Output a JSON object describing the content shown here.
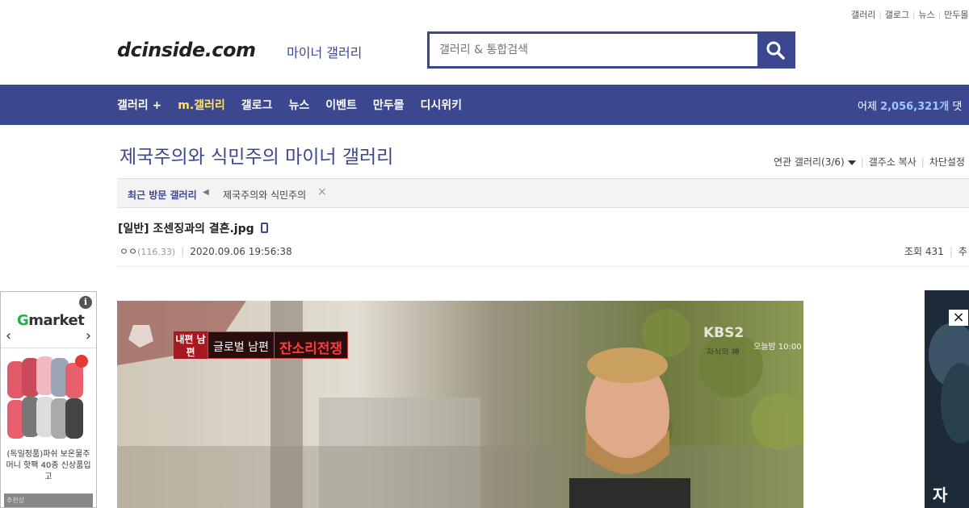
{
  "util_links": [
    "갤러리",
    "갤로그",
    "뉴스",
    "만두몰"
  ],
  "header": {
    "logo": "dcinside.com",
    "logo_sub": "마이너 갤러리",
    "search_placeholder": "갤러리 & 통합검색"
  },
  "gnb": {
    "items": [
      "갤러리 +",
      "m.갤러리",
      "갤로그",
      "뉴스",
      "이벤트",
      "만두몰",
      "디시위키"
    ],
    "stat_prefix": "어제",
    "stat_value": "2,056,321개",
    "stat_suffix": "댓"
  },
  "gallery": {
    "title": "제국주의와 식민주의 마이너 갤러리",
    "tools": [
      "연관 갤러리(3/6)",
      "갤주소 복사",
      "차단설정"
    ]
  },
  "recent": {
    "label": "최근 방문 갤러리",
    "item": "제국주의와 식민주의",
    "close": "×"
  },
  "post": {
    "title": "[일반] 조센징과의 결혼.jpg",
    "author": "ㅇㅇ",
    "ip": "(116.33)",
    "datetime": "2020.09.06 19:56:38",
    "views": "조회 431",
    "recommend": "추"
  },
  "ad_left": {
    "info": "i",
    "brand_g": "G",
    "brand_rest": "market",
    "prev": "‹",
    "next": "›",
    "desc": "(독일정품)파쉬 보온물주머니 핫팩 40종 신상품입고",
    "bottom": "추천상"
  },
  "image": {
    "cap_red": "내편 남편",
    "cap_text": "글로벌 남편",
    "cap_title": "잔소리전쟁",
    "broadcaster": "KBS2",
    "show": "자식의 神",
    "time": "오늘밤 10:00"
  },
  "ad_right": {
    "close": "×",
    "text": "자"
  },
  "colors": {
    "primary": "#3b4890",
    "active_nav": "#ffe36a",
    "gmarket_green": "#1fb24a"
  }
}
